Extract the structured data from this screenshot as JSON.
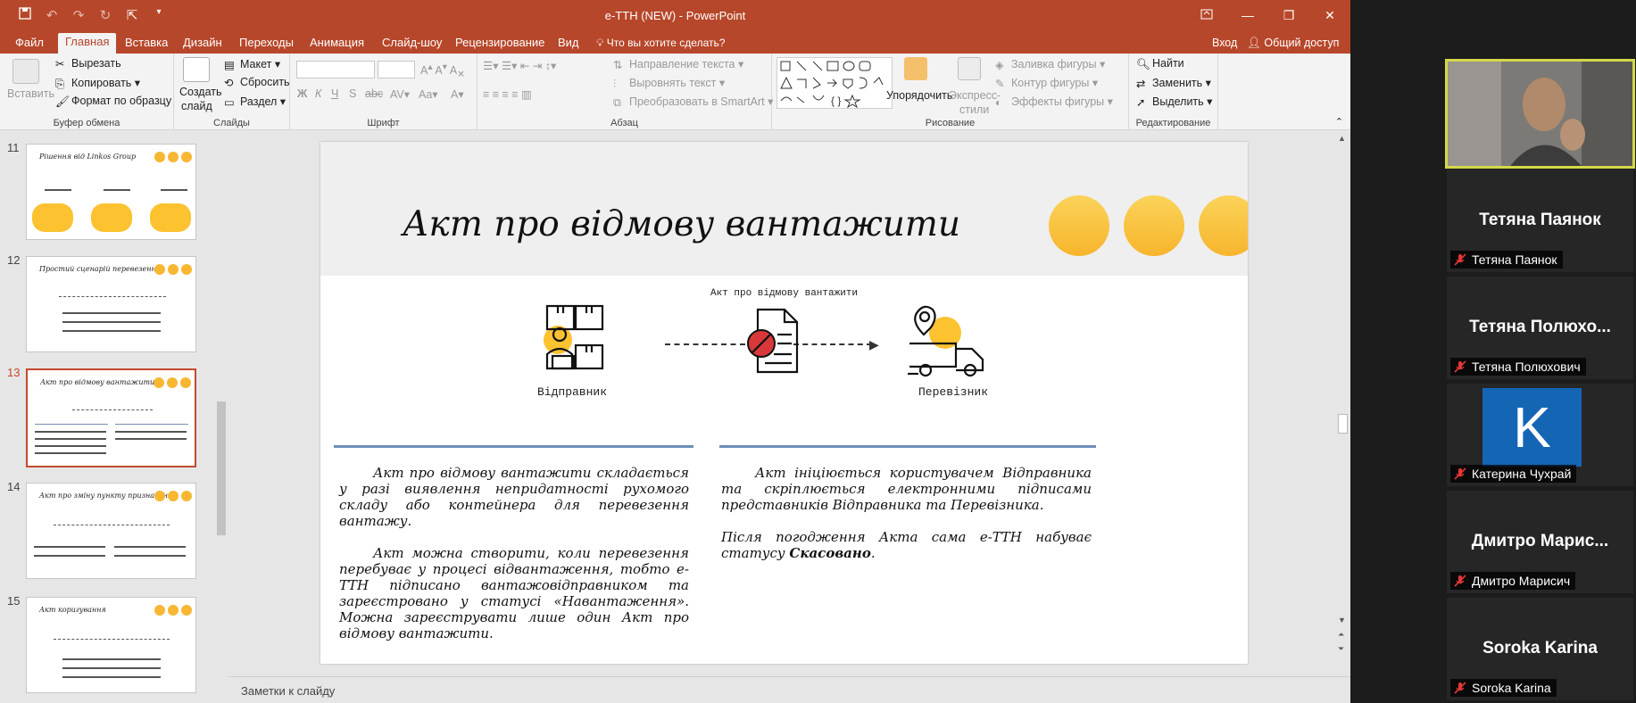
{
  "window": {
    "title": "e-TTH (NEW)  -  PowerPoint",
    "controls": [
      "restore-ribbon",
      "minimize",
      "maximize",
      "close"
    ]
  },
  "tabs": [
    {
      "label": "Файл"
    },
    {
      "label": "Главная"
    },
    {
      "label": "Вставка"
    },
    {
      "label": "Дизайн"
    },
    {
      "label": "Переходы"
    },
    {
      "label": "Анимация"
    },
    {
      "label": "Слайд-шоу"
    },
    {
      "label": "Рецензирование"
    },
    {
      "label": "Вид"
    }
  ],
  "tell_me": "Что вы хотите сделать?",
  "signin": "Вход",
  "share": "Общий доступ",
  "ribbon": {
    "clipboard": {
      "paste": "Вставить",
      "cut": "Вырезать",
      "copy": "Копировать",
      "format": "Формат по образцу",
      "label": "Буфер обмена"
    },
    "slides": {
      "create": "Создать",
      "slide": "слайд",
      "layout": "Макет",
      "reset": "Сбросить",
      "section": "Раздел",
      "label": "Слайды"
    },
    "font": {
      "label": "Шрифт"
    },
    "paragraph": {
      "direction": "Направление текста",
      "align": "Выровнять текст",
      "smartart": "Преобразовать в SmartArt",
      "label": "Абзац"
    },
    "drawing": {
      "arrange": "Упорядочить",
      "styles_1": "Экспресс-",
      "styles_2": "стили",
      "fill": "Заливка фигуры",
      "outline": "Контур фигуры",
      "effects": "Эффекты фигуры",
      "label": "Рисование"
    },
    "editing": {
      "find": "Найти",
      "replace": "Заменить",
      "select": "Выделить",
      "label": "Редактирование"
    }
  },
  "thumbnails": [
    {
      "num": "11",
      "title": "Рішення від Linkos Group"
    },
    {
      "num": "12",
      "title": "Простий сценарій перевезення"
    },
    {
      "num": "13",
      "title": "Акт про відмову вантажити"
    },
    {
      "num": "14",
      "title": "Акт про зміну пункту призначення"
    },
    {
      "num": "15",
      "title": "Акт коригування"
    }
  ],
  "slide": {
    "title": "Акт про відмову вантажити",
    "diagram_title": "Акт про відмову вантажити",
    "sender": "Відправник",
    "carrier": "Перевізник",
    "left_p1": "Акт про відмову вантажити складається у разі виявлення непридатності рухомого складу або контейнера для перевезення вантажу.",
    "left_p2": "Акт можна створити, коли перевезення перебуває у процесі відвантаження, тобто е-ТТН підписано вантажовідправником та зареєстровано у статусі «Навантаження». Можна зареєструвати лише один Акт про відмову вантажити.",
    "right_p1": "Акт ініціюється користувачем Відправника та скріплюється електронними підписами представників Відправника та Перевізника.",
    "right_p2_a": "Після погодження Акта сама е-ТТН набуває статусу ",
    "right_p2_b": "Скасовано",
    "right_p2_c": "."
  },
  "notes_placeholder": "Заметки к слайду",
  "participants": [
    {
      "tile": "Тетяна Паянок",
      "name": "Тетяна Паянок"
    },
    {
      "tile": "Тетяна Полюхо...",
      "name": "Тетяна Полюхович"
    },
    {
      "tile": "K",
      "name": "Катерина Чухрай"
    },
    {
      "tile": "Дмитро Марис...",
      "name": "Дмитро Марисич"
    },
    {
      "tile": "Soroka Karina",
      "name": "Soroka Karina"
    }
  ],
  "colors": {
    "accent": "#b7472a",
    "circle": "#f7b733",
    "rule": "#6f8db8",
    "muted_mic": "#e53935",
    "video_border": "#d4d84a",
    "avatar": "#1565b5"
  }
}
